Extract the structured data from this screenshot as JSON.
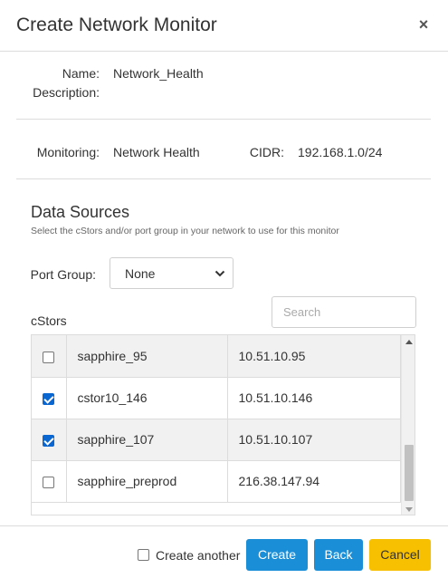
{
  "dialog": {
    "title": "Create Network Monitor",
    "close_icon": "close-icon"
  },
  "details": {
    "name_label": "Name:",
    "name_value": "Network_Health",
    "description_label": "Description:",
    "monitoring_label": "Monitoring:",
    "monitoring_value": "Network Health",
    "cidr_label": "CIDR:",
    "cidr_value": "192.168.1.0/24"
  },
  "data_sources": {
    "title": "Data Sources",
    "subtitle": "Select the cStors and/or port group in your network to use for this monitor",
    "port_group_label": "Port Group:",
    "port_group_value": "None",
    "cstors_label": "cStors",
    "search_placeholder": "Search"
  },
  "cstors_rows": [
    {
      "name": "sapphire_95",
      "ip": "10.51.10.95",
      "checked": false
    },
    {
      "name": "cstor10_146",
      "ip": "10.51.10.146",
      "checked": true
    },
    {
      "name": "sapphire_107",
      "ip": "10.51.10.107",
      "checked": true
    },
    {
      "name": "sapphire_preprod",
      "ip": "216.38.147.94",
      "checked": false
    }
  ],
  "footer": {
    "create_another_label": "Create another",
    "create_another_checked": false,
    "create_label": "Create",
    "back_label": "Back",
    "cancel_label": "Cancel"
  },
  "colors": {
    "primary": "#1a8fd8",
    "cancel": "#f7c000",
    "checkbox_checked": "#0a66d0"
  }
}
